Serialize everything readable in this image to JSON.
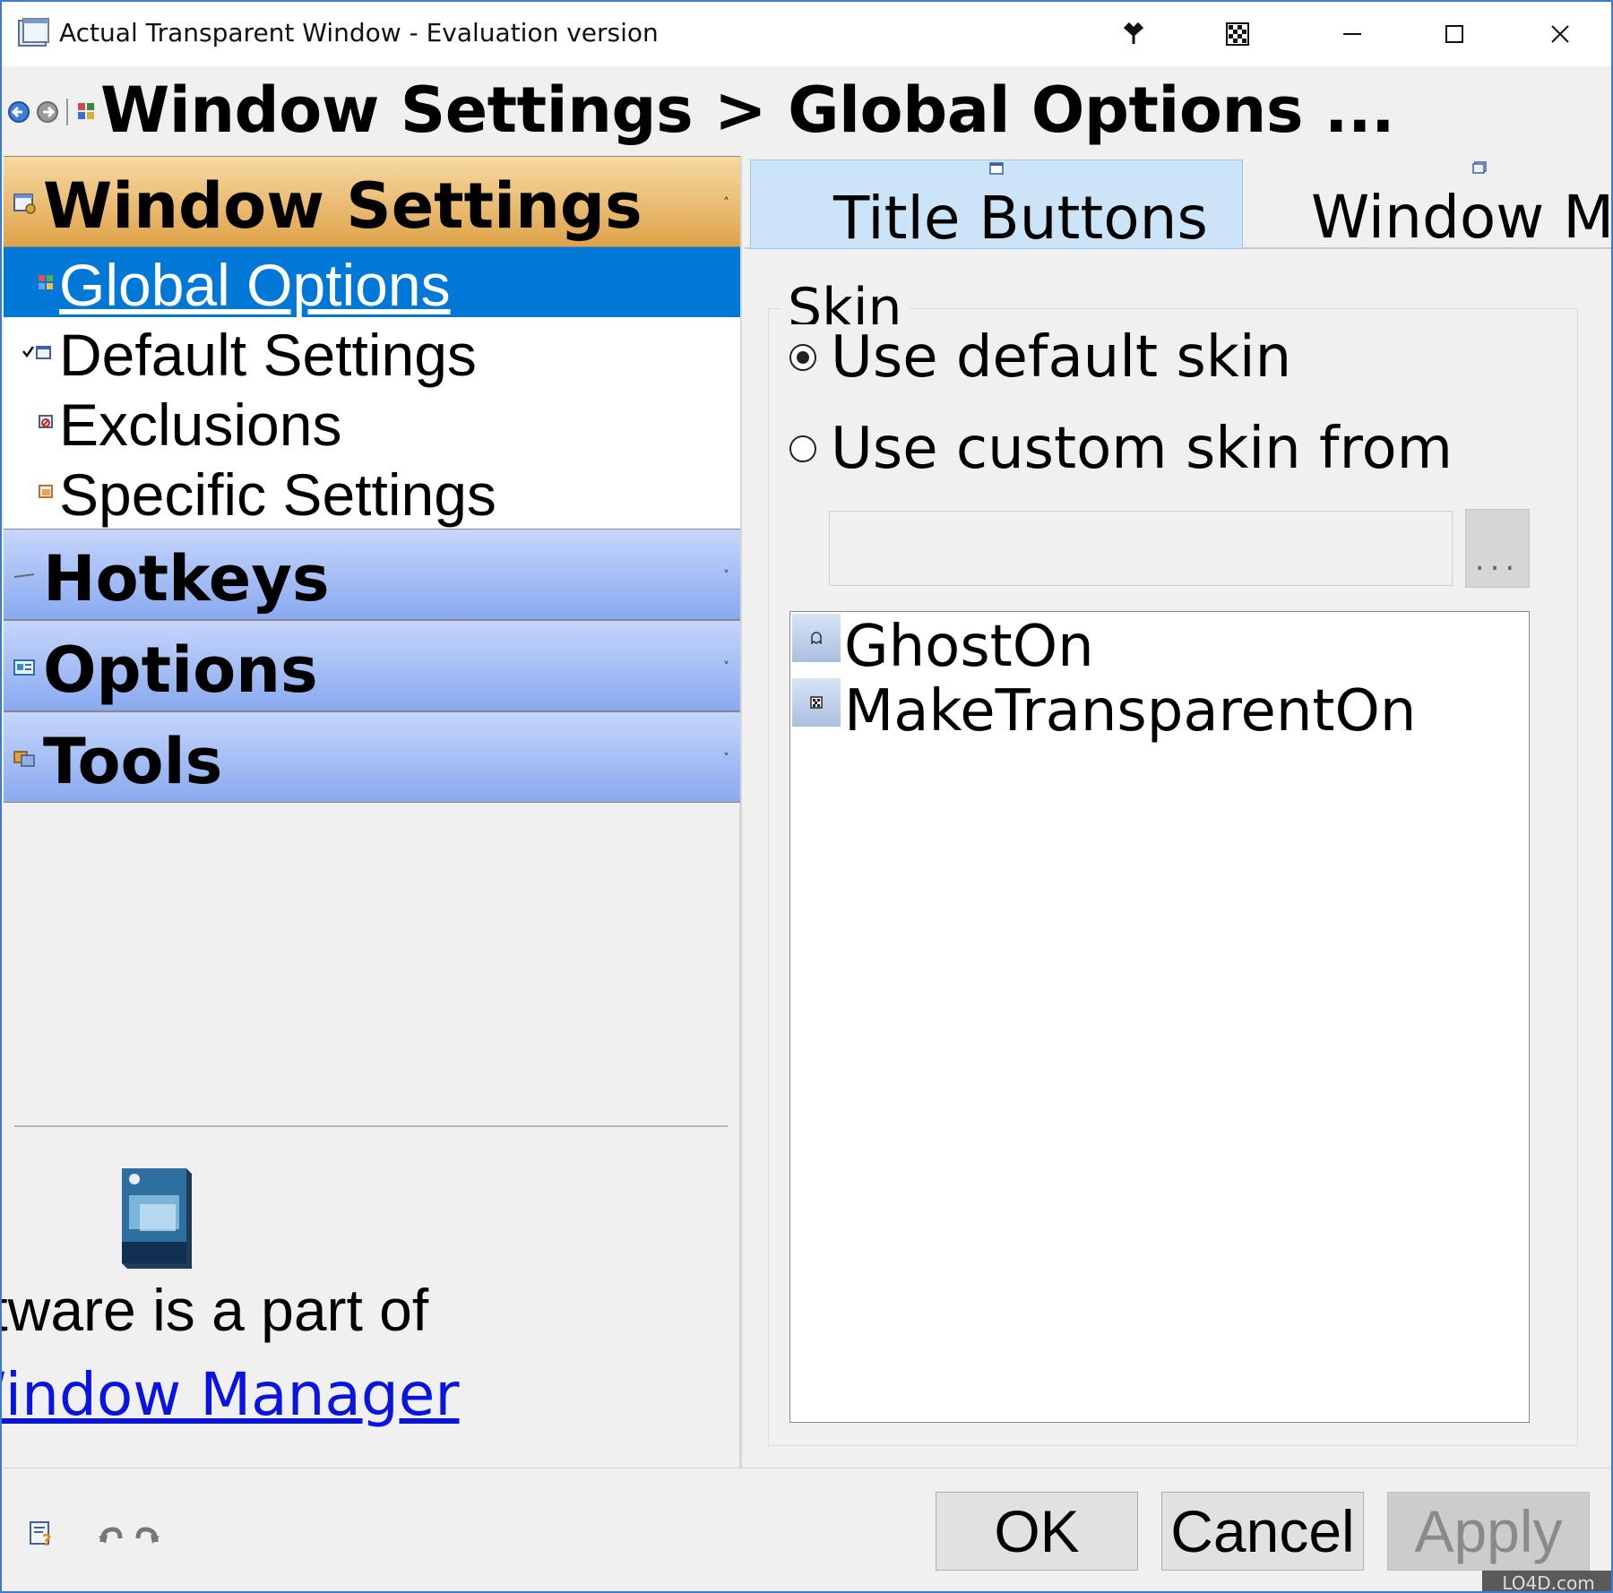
{
  "window": {
    "title": "Actual Transparent Window - Evaluation version",
    "accent_color": "#3a7bd5"
  },
  "titlebar_buttons": [
    {
      "name": "pin-icon"
    },
    {
      "name": "transparency-icon"
    },
    {
      "name": "minimize-icon"
    },
    {
      "name": "maximize-icon"
    },
    {
      "name": "close-icon"
    }
  ],
  "header": {
    "breadcrumb": "Window Settings > Global Options ..."
  },
  "sidebar": {
    "active_section": {
      "title": "Window Settings",
      "chevron": "˄",
      "color": "#dea34a",
      "items": [
        {
          "label": "Global Options",
          "selected": true
        },
        {
          "label": "Default Settings",
          "selected": false
        },
        {
          "label": "Exclusions",
          "selected": false
        },
        {
          "label": "Specific Settings",
          "selected": false
        }
      ]
    },
    "sections": [
      {
        "title": "Hotkeys",
        "chevron": "˅"
      },
      {
        "title": "Options",
        "chevron": "˅"
      },
      {
        "title": "Tools",
        "chevron": "˅"
      }
    ],
    "promo": {
      "text": "ftware is a part of",
      "link": "Window Manager"
    }
  },
  "tabs": [
    {
      "label": "Title Buttons",
      "active": true
    },
    {
      "label": "Window Me",
      "active": false
    }
  ],
  "skin": {
    "group_title": "Skin",
    "option_default": "Use default skin",
    "option_custom": "Use custom skin from",
    "selected": "default",
    "path_value": "",
    "browse_label": "...",
    "list_items": [
      {
        "label": "GhostOn",
        "icon": "ghost-icon"
      },
      {
        "label": "MakeTransparentOn",
        "icon": "transparent-icon"
      }
    ]
  },
  "footer": {
    "ok": "OK",
    "cancel": "Cancel",
    "apply": "Apply",
    "badge": "LO4D.com"
  }
}
